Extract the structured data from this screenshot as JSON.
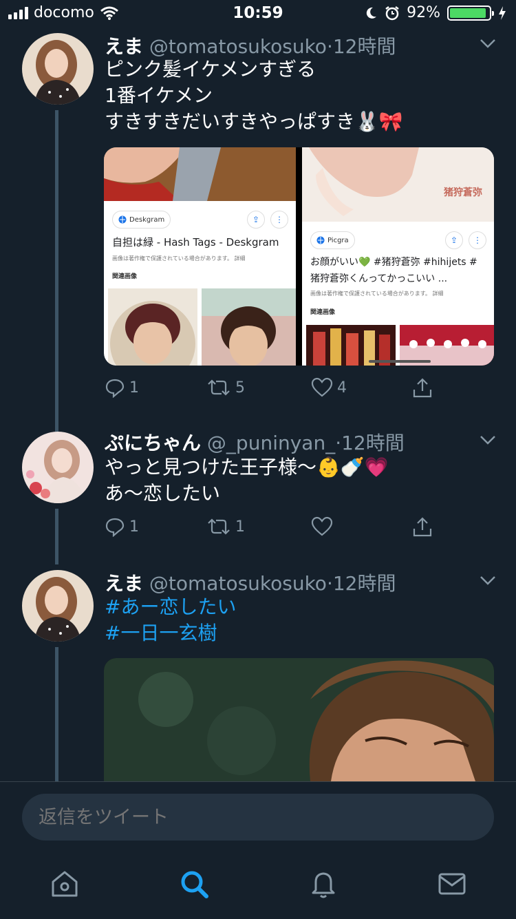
{
  "status_bar": {
    "carrier": "docomo",
    "time": "10:59",
    "battery": "92%",
    "battery_fill": 0.92
  },
  "tweets": [
    {
      "name": "えま",
      "handle": "@tomatosukosuko",
      "time": "·12時間",
      "lines": [
        "ピンク髪イケメンすぎる",
        "1番イケメン",
        "すきすきだいすきやっぱすき🐰🎀"
      ],
      "actions": {
        "reply": "1",
        "retweet": "5",
        "like": "4"
      },
      "cards": [
        {
          "source": "Deskgram",
          "title": "自担は緑 - Hash Tags - Deskgram",
          "note": "画像は著作権で保護されている場合があります。 詳細",
          "related": "関連画像"
        },
        {
          "source": "Picgra",
          "title_line1": "お顔がいい💚 #猪狩蒼弥 #hihijets #",
          "title_line2": "猪狩蒼弥くんってかっこいい ...",
          "note": "画像は著作権で保護されている場合があります。 詳細",
          "related": "関連画像",
          "photo_caption": "猪狩蒼弥"
        }
      ]
    },
    {
      "name": "ぷにちゃん",
      "handle": "@_puninyan_",
      "time": "·12時間",
      "lines": [
        "やっと見つけた王子様〜👶🍼💗",
        "あ〜恋したい"
      ],
      "actions": {
        "reply": "1",
        "retweet": "1",
        "like": ""
      }
    },
    {
      "name": "えま",
      "handle": "@tomatosukosuko",
      "time": "·12時間",
      "hashtags": [
        "#あー恋したい",
        "#一日一玄樹"
      ]
    }
  ],
  "reply": {
    "placeholder": "返信をツイート"
  },
  "icons": {
    "home": "home-icon",
    "search": "search-icon",
    "notifications": "bell-icon",
    "messages": "mail-icon"
  },
  "colors": {
    "background": "#15202b",
    "accent": "#1da1f2",
    "muted": "#8899a6"
  }
}
